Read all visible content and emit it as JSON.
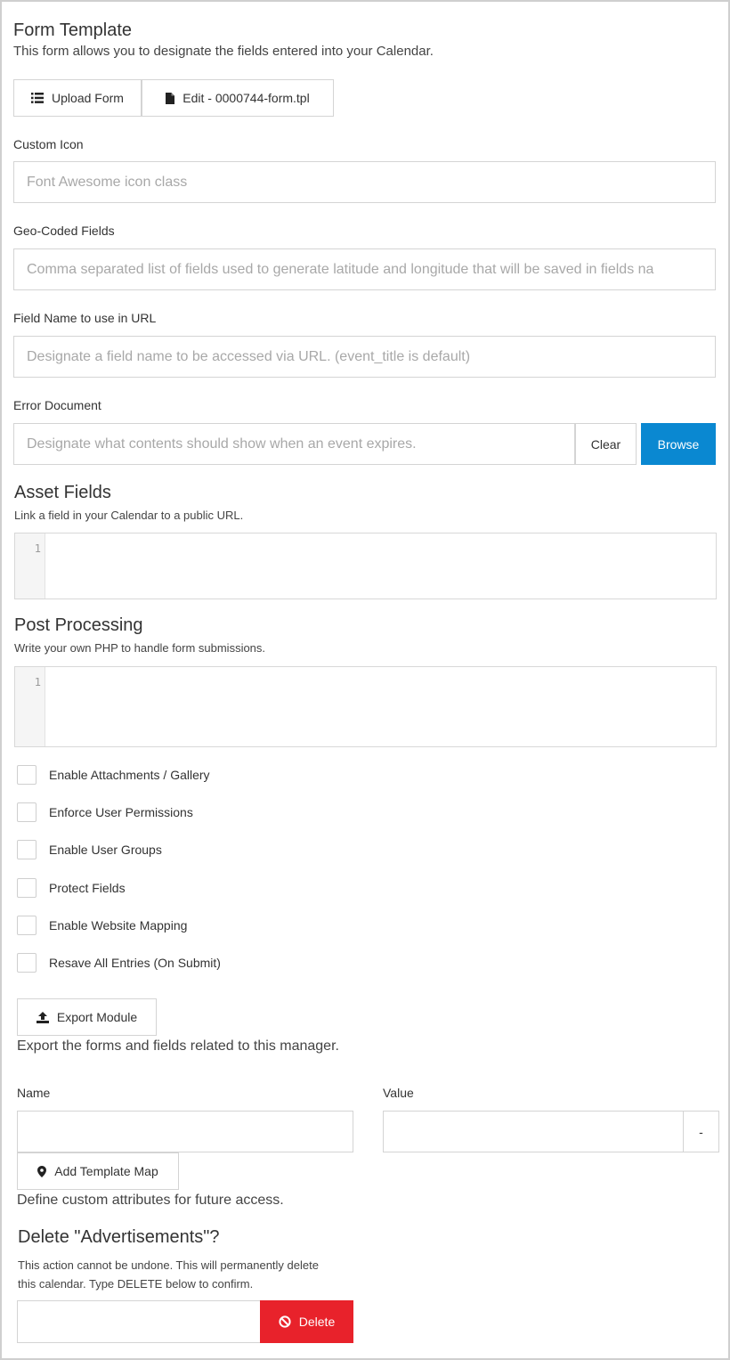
{
  "form_template": {
    "title": "Form Template",
    "description": "This form allows you to designate the fields entered into your Calendar.",
    "upload_label": "Upload Form",
    "edit_label": "Edit - 0000744-form.tpl"
  },
  "custom_icon": {
    "label": "Custom Icon",
    "placeholder": "Font Awesome icon class"
  },
  "geo_coded": {
    "label": "Geo-Coded Fields",
    "placeholder": "Comma separated list of fields used to generate latitude and longitude that will be saved in fields na"
  },
  "field_name_url": {
    "label": "Field Name to use in URL",
    "placeholder": "Designate a field name to be accessed via URL. (event_title is default)"
  },
  "error_document": {
    "label": "Error Document",
    "placeholder": "Designate what contents should show when an event expires.",
    "clear_label": "Clear",
    "browse_label": "Browse"
  },
  "asset_fields": {
    "title": "Asset Fields",
    "description": "Link a field in your Calendar to a public URL.",
    "line_number": "1"
  },
  "post_processing": {
    "title": "Post Processing",
    "description": "Write your own PHP to handle form submissions.",
    "line_number": "1"
  },
  "options": [
    {
      "label": "Enable Attachments / Gallery"
    },
    {
      "label": "Enforce User Permissions"
    },
    {
      "label": "Enable User Groups"
    },
    {
      "label": "Protect Fields"
    },
    {
      "label": "Enable Website Mapping"
    },
    {
      "label": "Resave All Entries (On Submit)"
    }
  ],
  "export": {
    "button_label": "Export Module",
    "description": "Export the forms and fields related to this manager."
  },
  "template_map": {
    "name_label": "Name",
    "value_label": "Value",
    "remove_label": "-",
    "add_label": "Add Template Map",
    "description": "Define custom attributes for future access."
  },
  "delete_section": {
    "title": "Delete \"Advertisements\"?",
    "warning_line1": "This action cannot be undone. This will permanently delete",
    "warning_line2": "this calendar. Type DELETE below to confirm.",
    "button_label": "Delete"
  },
  "colors": {
    "primary": "#0a88d1",
    "danger": "#e8222b"
  },
  "icons": {
    "upload_form": "list-icon",
    "edit_form": "file-icon",
    "export": "upload-icon",
    "add_map": "map-marker-icon",
    "delete": "ban-icon"
  }
}
